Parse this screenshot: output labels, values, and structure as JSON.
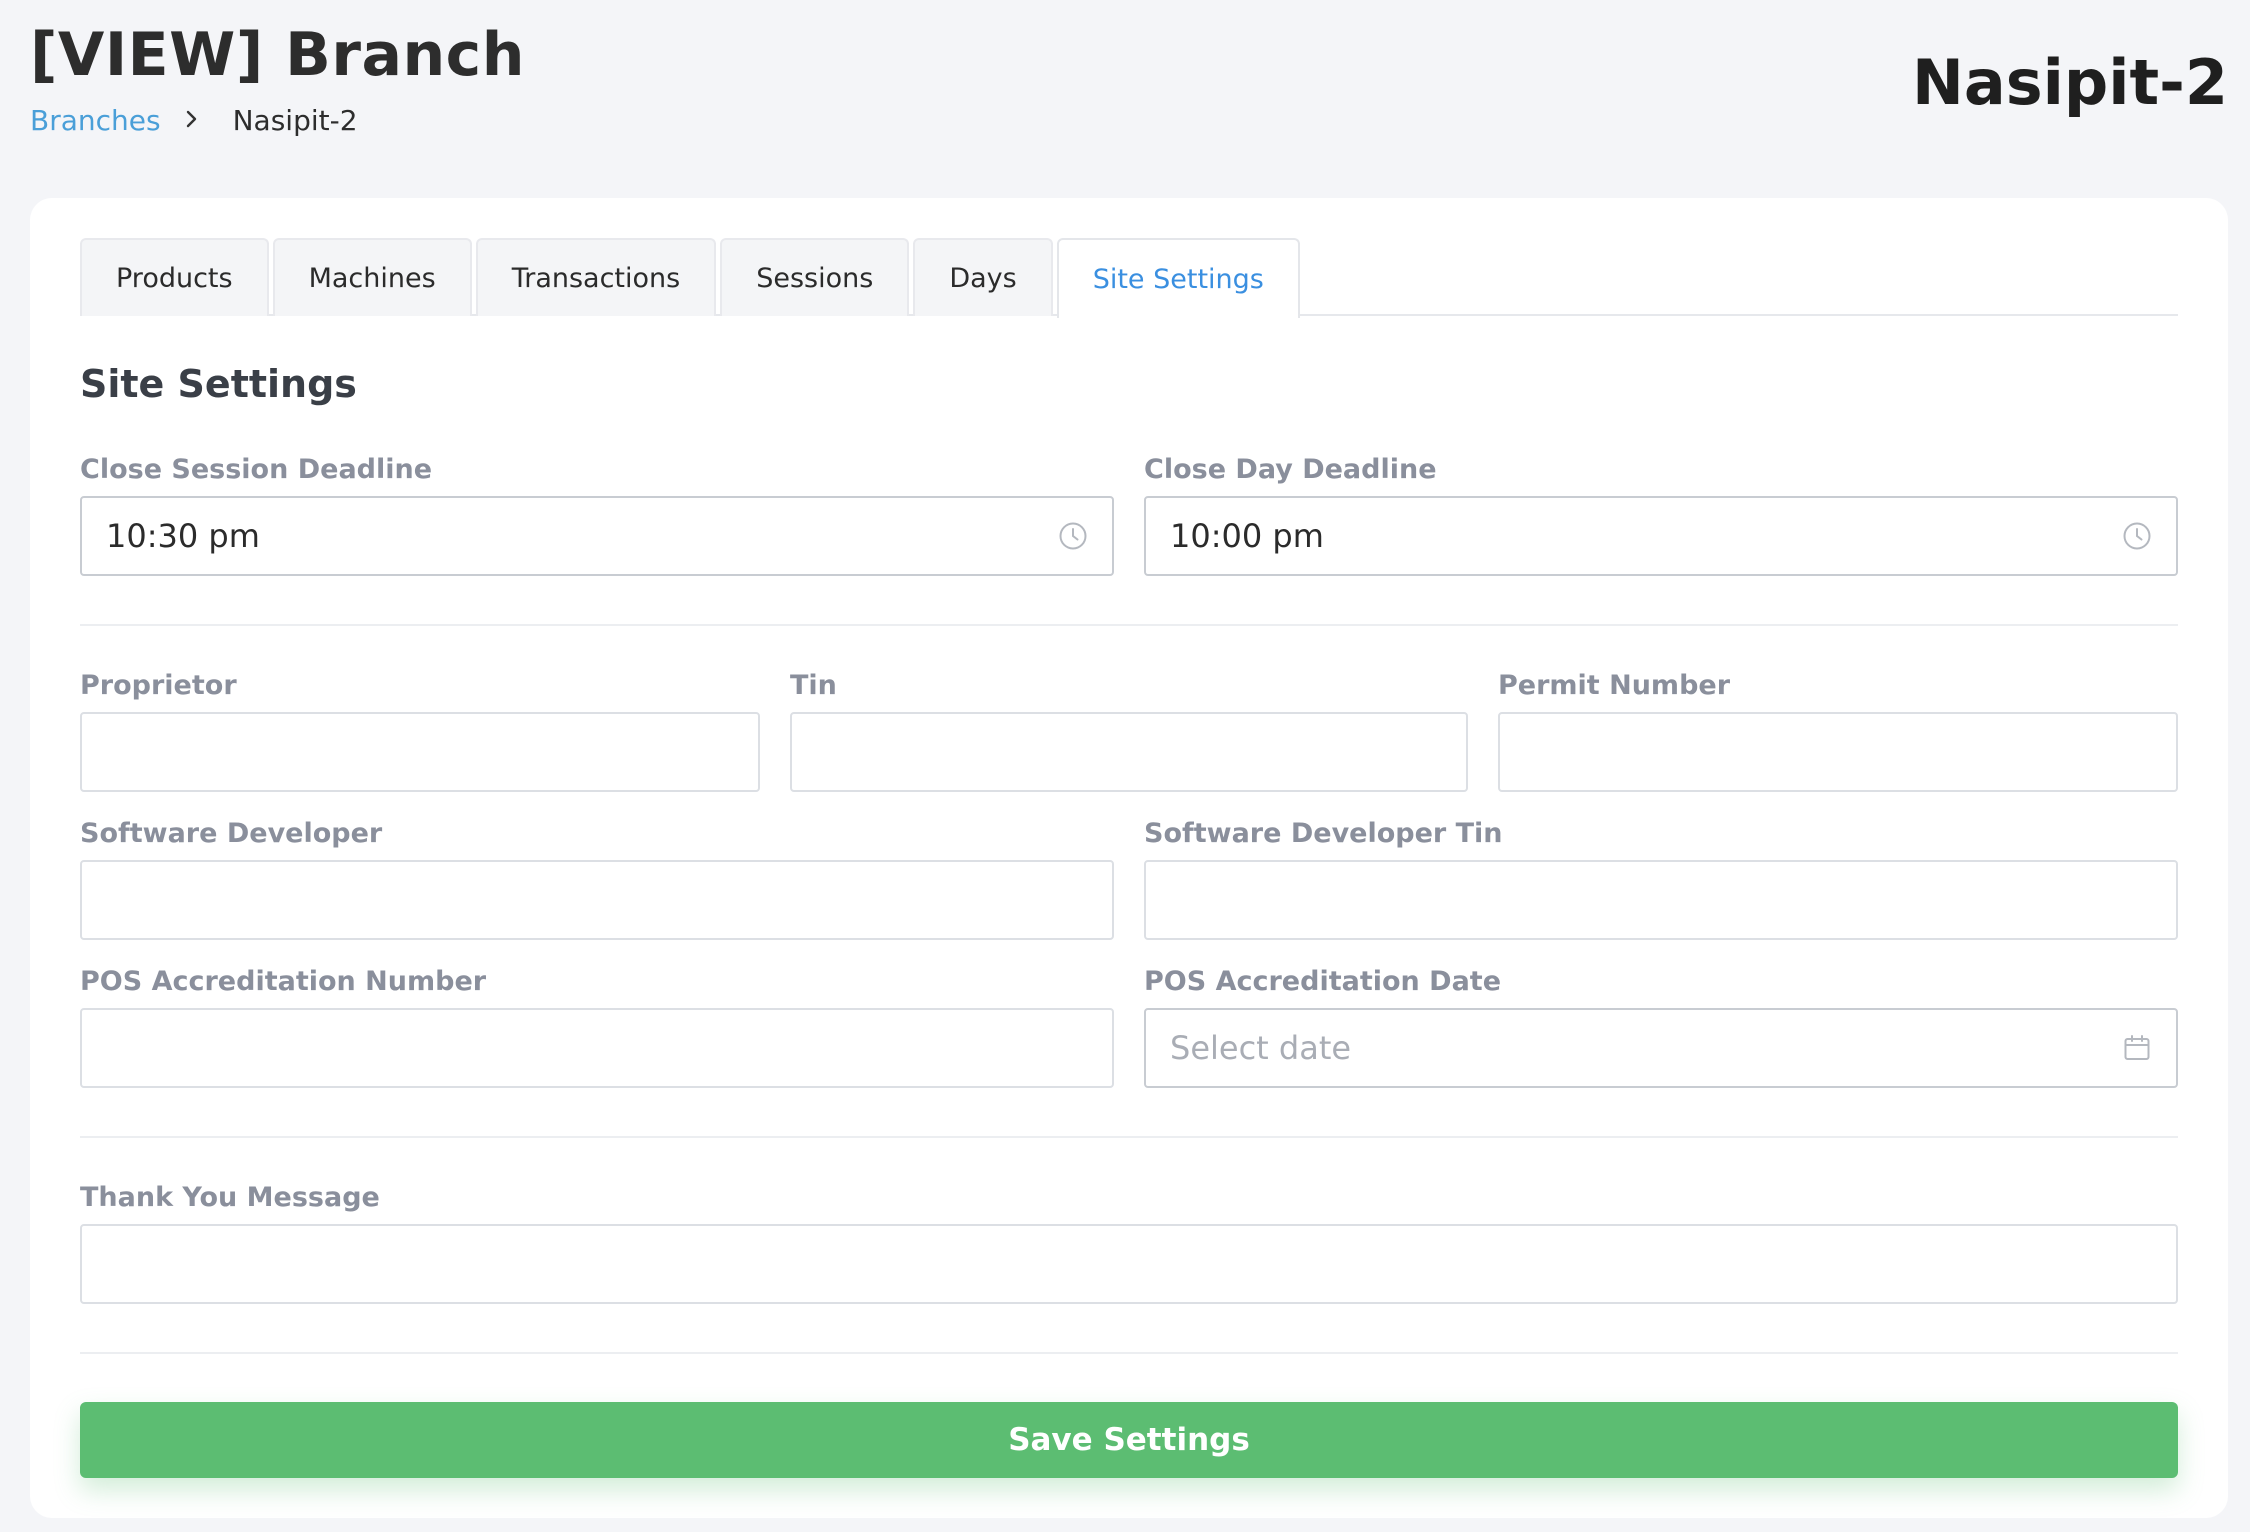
{
  "header": {
    "title": "[VIEW] Branch",
    "branch_name": "Nasipit-2"
  },
  "breadcrumb": {
    "link": "Branches",
    "current": "Nasipit-2"
  },
  "tabs": [
    {
      "label": "Products",
      "active": false
    },
    {
      "label": "Machines",
      "active": false
    },
    {
      "label": "Transactions",
      "active": false
    },
    {
      "label": "Sessions",
      "active": false
    },
    {
      "label": "Days",
      "active": false
    },
    {
      "label": "Site Settings",
      "active": true
    }
  ],
  "section": {
    "title": "Site Settings"
  },
  "form": {
    "close_session_deadline": {
      "label": "Close Session Deadline",
      "value": "10:30 pm",
      "icon": "clock-icon"
    },
    "close_day_deadline": {
      "label": "Close Day Deadline",
      "value": "10:00 pm",
      "icon": "clock-icon"
    },
    "proprietor": {
      "label": "Proprietor",
      "value": ""
    },
    "tin": {
      "label": "Tin",
      "value": ""
    },
    "permit_number": {
      "label": "Permit Number",
      "value": ""
    },
    "software_developer": {
      "label": "Software Developer",
      "value": ""
    },
    "software_developer_tin": {
      "label": "Software Developer Tin",
      "value": ""
    },
    "pos_accreditation_number": {
      "label": "POS Accreditation Number",
      "value": ""
    },
    "pos_accreditation_date": {
      "label": "POS Accreditation Date",
      "placeholder": "Select date",
      "icon": "calendar-icon"
    },
    "thank_you_message": {
      "label": "Thank You Message",
      "value": ""
    }
  },
  "actions": {
    "save_label": "Save Settings"
  },
  "colors": {
    "accent": "#3a8fe0",
    "link": "#4a9fd8",
    "save_button": "#5cbd72",
    "label": "#8a8f9c",
    "background": "#f4f5f8"
  }
}
